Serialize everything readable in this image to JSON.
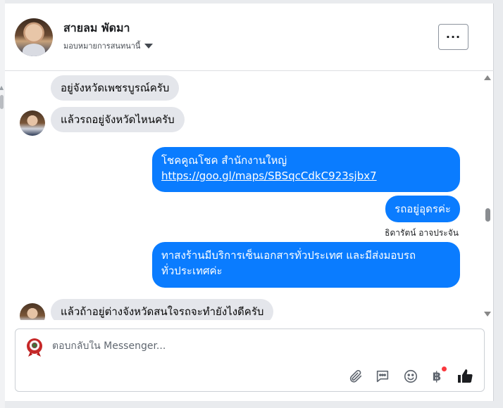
{
  "header": {
    "contact_name": "สายลม พัดมา",
    "assign_label": "มอบหมายการสนทนานี้",
    "more_label": "···"
  },
  "messages": [
    {
      "direction": "in",
      "text": "อยู่จังหวัดเพชรบูรณ์ครับ"
    },
    {
      "direction": "in",
      "text": "แล้วรถอยู่จังหวัดไหนครับ"
    },
    {
      "direction": "out",
      "line1": "โชคคูณโชค สำนักงานใหญ่",
      "link": "https://goo.gl/maps/SBSqcCdkC923sjbx7"
    },
    {
      "direction": "out",
      "text": "รถอยู่อุดรค่ะ"
    },
    {
      "direction": "meta",
      "text": "ธิดารัตน์ อาจประจัน"
    },
    {
      "direction": "out",
      "line1": "ทาสงร้านมีบริการเซ็นเอกสารทั่วประเทศ และมีส่งมอบรถ",
      "line2": "ทั่วประเทศค่ะ"
    },
    {
      "direction": "in",
      "text": "แล้วถ้าอยู่ต่างจังหวัดสนใจรถจะทำยังไงดีครับ"
    }
  ],
  "composer": {
    "placeholder": "ตอบกลับใน Messenger...",
    "value": "",
    "tools": [
      "attachment-icon",
      "saved-replies-icon",
      "emoji-icon",
      "payment-baht-icon",
      "like-icon"
    ],
    "baht_symbol": "฿"
  },
  "colors": {
    "outgoing_bubble": "#0a7cff",
    "incoming_bubble": "#e4e6eb",
    "notification_dot": "#fa383e"
  }
}
